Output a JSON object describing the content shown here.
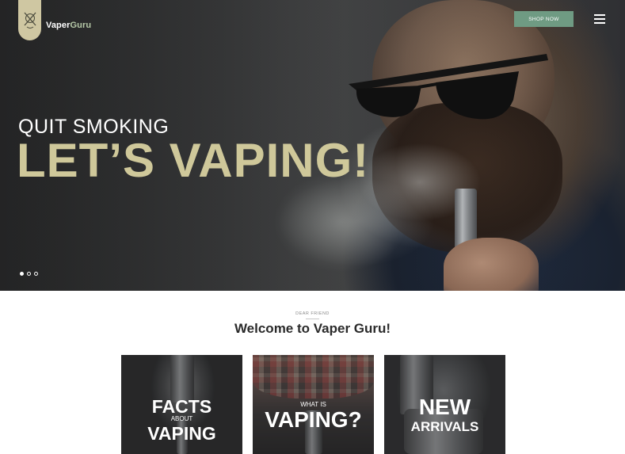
{
  "header": {
    "brand_part1": "Vaper",
    "brand_part2": "Guru",
    "shop_button": "SHOP NOW",
    "menu_icon": "hamburger-menu-icon"
  },
  "hero": {
    "subtitle": "QUIT SMOKING",
    "title": "LET’S VAPING!",
    "slides": [
      {
        "active": true
      },
      {
        "active": false
      },
      {
        "active": false
      }
    ],
    "accent_color": "#cfc89a"
  },
  "welcome": {
    "eyebrow": "DEAR FRIEND",
    "heading": "Welcome to Vaper Guru!"
  },
  "cards": [
    {
      "line1": "FACTS",
      "line2": "ABOUT",
      "line3": "VAPING"
    },
    {
      "line1": "WHAT IS",
      "line2": "VAPING?"
    },
    {
      "line1": "NEW",
      "line2": "ARRIVALS"
    }
  ],
  "colors": {
    "shop_button_bg": "#6f9b83",
    "logo_bg": "#cfc7a2",
    "brand_accent": "#b6c9a8"
  }
}
